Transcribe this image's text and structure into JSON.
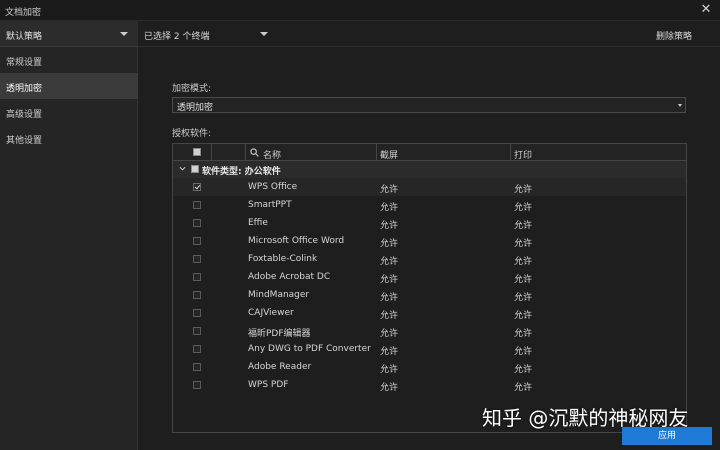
{
  "window": {
    "title": "文档加密"
  },
  "sidebar": {
    "policy_select": "默认策略",
    "items": [
      {
        "label": "常规设置",
        "active": false
      },
      {
        "label": "透明加密",
        "active": true
      },
      {
        "label": "高级设置",
        "active": false
      },
      {
        "label": "其他设置",
        "active": false
      }
    ]
  },
  "topbar": {
    "terminal_select": "已选择 2 个终端",
    "delete_policy": "删除策略"
  },
  "main": {
    "mode_label": "加密模式:",
    "mode_value": "透明加密",
    "software_label": "授权软件:"
  },
  "table": {
    "headers": {
      "name": "名称",
      "screenshot": "截屏",
      "print": "打印"
    },
    "group": {
      "label": "软件类型: 办公软件"
    },
    "rows": [
      {
        "name": "WPS Office",
        "screenshot": "允许",
        "print": "允许",
        "checked": true
      },
      {
        "name": "SmartPPT",
        "screenshot": "允许",
        "print": "允许",
        "checked": false
      },
      {
        "name": "Effie",
        "screenshot": "允许",
        "print": "允许",
        "checked": false
      },
      {
        "name": "Microsoft Office Word",
        "screenshot": "允许",
        "print": "允许",
        "checked": false
      },
      {
        "name": "Foxtable-Colink",
        "screenshot": "允许",
        "print": "允许",
        "checked": false
      },
      {
        "name": "Adobe Acrobat DC",
        "screenshot": "允许",
        "print": "允许",
        "checked": false
      },
      {
        "name": "MindManager",
        "screenshot": "允许",
        "print": "允许",
        "checked": false
      },
      {
        "name": "CAJViewer",
        "screenshot": "允许",
        "print": "允许",
        "checked": false
      },
      {
        "name": "福昕PDF编辑器",
        "screenshot": "允许",
        "print": "允许",
        "checked": false
      },
      {
        "name": "Any DWG to PDF Converter",
        "screenshot": "允许",
        "print": "允许",
        "checked": false
      },
      {
        "name": "Adobe Reader",
        "screenshot": "允许",
        "print": "允许",
        "checked": false
      },
      {
        "name": "WPS PDF",
        "screenshot": "允许",
        "print": "允许",
        "checked": false
      }
    ]
  },
  "footer": {
    "apply": "应用"
  },
  "watermark": "知乎 @沉默的神秘网友",
  "colors": {
    "accent": "#1e7ad6",
    "background": "#1e1e1e",
    "sidebar": "#252526",
    "active_nav": "#3b3b3b"
  }
}
